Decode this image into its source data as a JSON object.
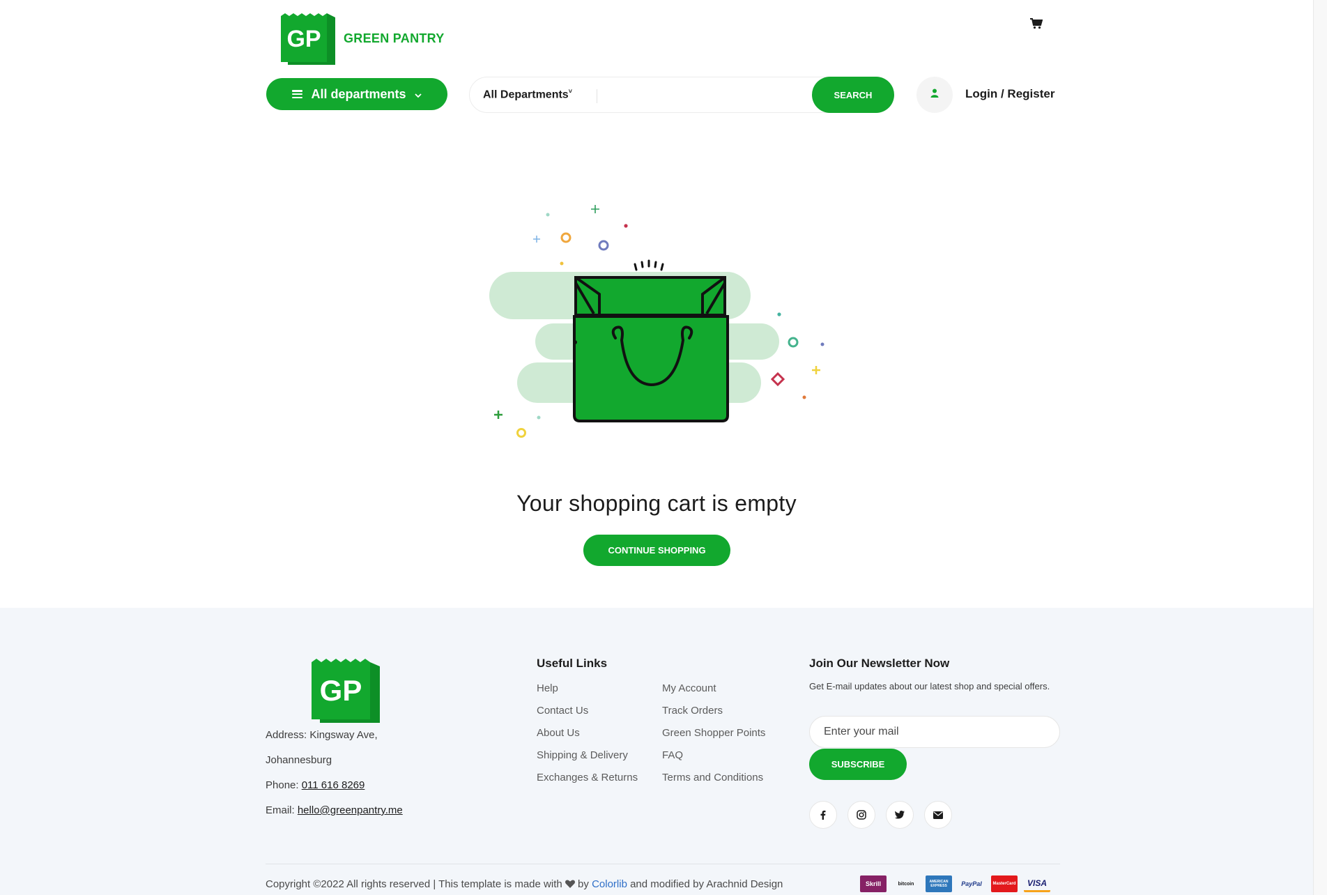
{
  "header": {
    "brand_initials": "GP",
    "brand_name": "GREEN PANTRY",
    "departments_button": "All departments",
    "search_department": "All Departments",
    "search_placeholder": "",
    "search_button": "SEARCH",
    "login": "Login / Register"
  },
  "hero": {
    "empty_message": "Your shopping cart is empty",
    "continue_button": "CONTINUE SHOPPING"
  },
  "footer": {
    "brand_initials": "GP",
    "address_line1": "Address: Kingsway Ave,",
    "address_line2": "Johannesburg",
    "phone_label": "Phone: ",
    "phone_value": "011 616 8269",
    "email_label": "Email: ",
    "email_value": "hello@greenpantry.me",
    "useful_links_heading": "Useful Links",
    "links_col1": [
      "Help",
      "Contact Us",
      "About Us",
      "Shipping & Delivery",
      "Exchanges & Returns"
    ],
    "links_col2": [
      "My Account",
      "Track Orders",
      "Green Shopper Points",
      "FAQ",
      "Terms and Conditions"
    ],
    "newsletter_heading": "Join Our Newsletter Now",
    "newsletter_text": "Get E-mail updates about our latest shop and special offers.",
    "mail_placeholder": "Enter your mail",
    "subscribe_button": "SUBSCRIBE",
    "social_icons": [
      "facebook-icon",
      "instagram-icon",
      "twitter-icon",
      "envelope-icon"
    ],
    "copyright_part1": "Copyright ©2022 All rights reserved | This template is made with",
    "copyright_by": " by ",
    "copyright_link": "Colorlib",
    "copyright_part2": " and modified by Arachnid Design",
    "payment_methods": [
      "Skrill",
      "bitcoin",
      "AMERICAN EXPRESS",
      "PayPal",
      "MasterCard",
      "VISA"
    ]
  },
  "colors": {
    "brand_green": "#12a82e",
    "footer_bg": "#f3f6fa",
    "link_blue": "#2f6fc8"
  }
}
